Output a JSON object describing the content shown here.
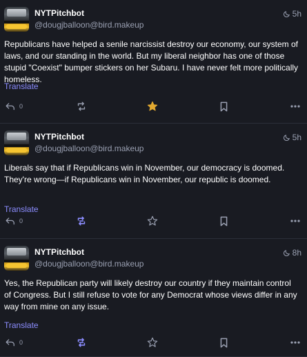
{
  "colors": {
    "background": "#191b22",
    "muted": "#9aa0b2",
    "link": "#8c8dff",
    "favourited": "#e2a930",
    "boosted": "#8c8dff"
  },
  "posts": [
    {
      "display_name": "NYTPitchbot",
      "handle": "@dougjballoon@bird.makeup",
      "time": "5h",
      "content": "Republicans have helped a senile narcissist destroy our economy, our system of laws, and our standing in the world.  But my liberal neighbor has one of those stupid \"Coexist\" bumper stickers on her Subaru.  I have never felt more politically homeless.",
      "translate": "Translate",
      "reply_count": "0",
      "favourited": true,
      "boosted": false
    },
    {
      "display_name": "NYTPitchbot",
      "handle": "@dougjballoon@bird.makeup",
      "time": "5h",
      "content": "Liberals say that if Republicans win in November, our democracy is doomed.  They're wrong—if Republicans win in November, our republic is doomed.",
      "translate": "Translate",
      "reply_count": "0",
      "favourited": false,
      "boosted": true
    },
    {
      "display_name": "NYTPitchbot",
      "handle": "@dougjballoon@bird.makeup",
      "time": "8h",
      "content": "Yes, the Republican party will likely destroy our country if they maintain control of Congress.  But I still refuse to vote for any Democrat whose views differ in any way from mine on any issue.",
      "translate": "Translate",
      "reply_count": "0",
      "favourited": false,
      "boosted": true
    }
  ]
}
